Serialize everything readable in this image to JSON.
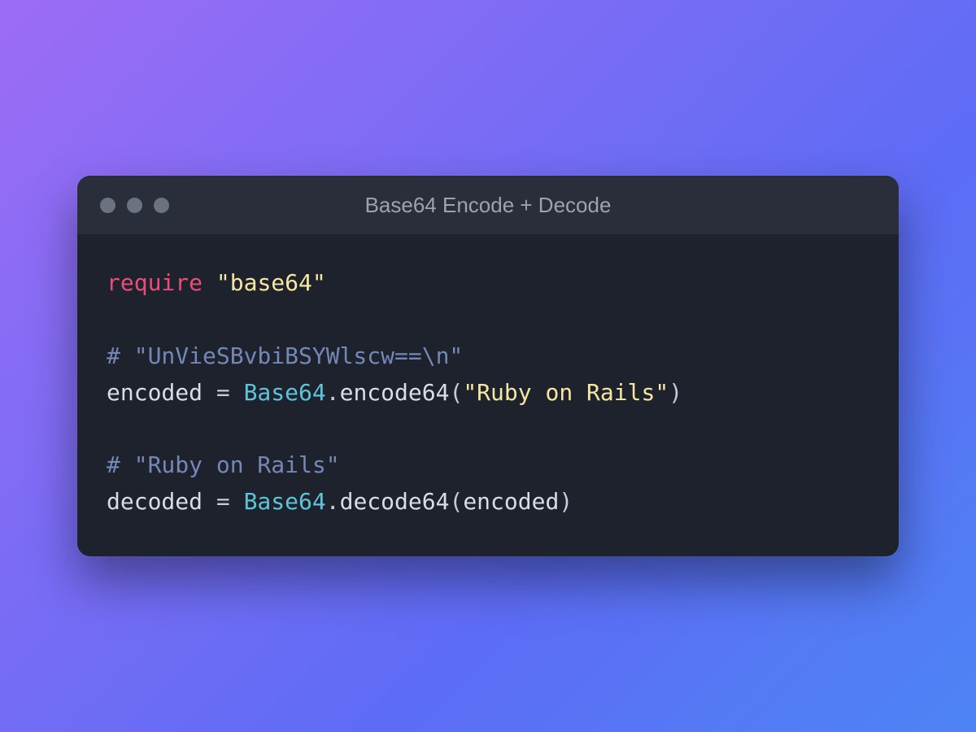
{
  "window": {
    "title": "Base64 Encode + Decode"
  },
  "code": {
    "lines": [
      [
        {
          "cls": "tok-keyword",
          "text": "require"
        },
        {
          "cls": "tok-ident",
          "text": " "
        },
        {
          "cls": "tok-string",
          "text": "\"base64\""
        }
      ],
      [],
      [
        {
          "cls": "tok-comment",
          "text": "# \"UnVieSBvbiBSYWlscw==\\n\""
        }
      ],
      [
        {
          "cls": "tok-ident",
          "text": "encoded "
        },
        {
          "cls": "tok-punct",
          "text": "="
        },
        {
          "cls": "tok-ident",
          "text": " "
        },
        {
          "cls": "tok-const",
          "text": "Base64"
        },
        {
          "cls": "tok-punct",
          "text": "."
        },
        {
          "cls": "tok-ident",
          "text": "encode64"
        },
        {
          "cls": "tok-punct",
          "text": "("
        },
        {
          "cls": "tok-string",
          "text": "\"Ruby on Rails\""
        },
        {
          "cls": "tok-punct",
          "text": ")"
        }
      ],
      [],
      [
        {
          "cls": "tok-comment",
          "text": "# \"Ruby on Rails\""
        }
      ],
      [
        {
          "cls": "tok-ident",
          "text": "decoded "
        },
        {
          "cls": "tok-punct",
          "text": "="
        },
        {
          "cls": "tok-ident",
          "text": " "
        },
        {
          "cls": "tok-const",
          "text": "Base64"
        },
        {
          "cls": "tok-punct",
          "text": "."
        },
        {
          "cls": "tok-ident",
          "text": "decode64"
        },
        {
          "cls": "tok-punct",
          "text": "("
        },
        {
          "cls": "tok-ident",
          "text": "encoded"
        },
        {
          "cls": "tok-punct",
          "text": ")"
        }
      ]
    ]
  }
}
